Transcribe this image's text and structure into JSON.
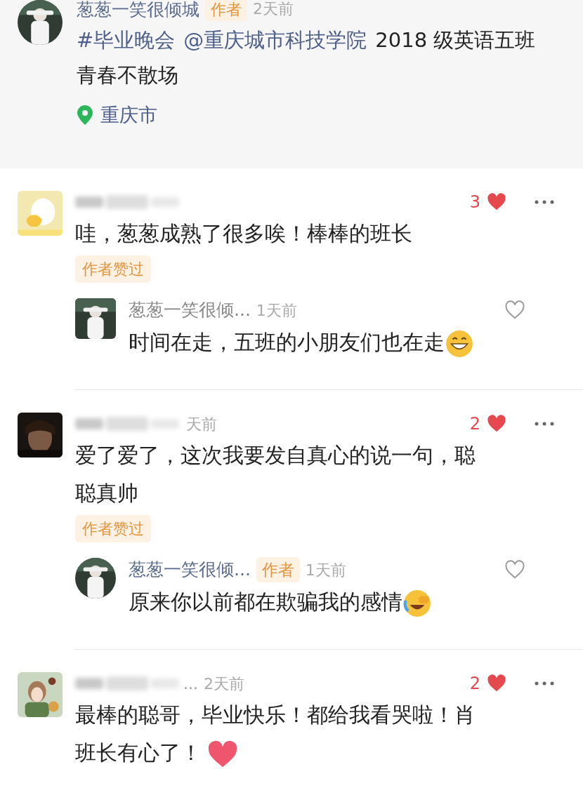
{
  "post": {
    "author": "葱葱一笑很倾城",
    "badge": "作者",
    "time": "2天前",
    "segments": [
      {
        "kind": "link",
        "text": "#毕业晚会"
      },
      {
        "kind": "link",
        "text": "@重庆城市科技学院"
      },
      {
        "kind": "plain",
        "text": "2018 级英语五班"
      },
      {
        "kind": "plain",
        "text": "青春不散场"
      }
    ],
    "location": "重庆市"
  },
  "comments": [
    {
      "text": "哇，葱葱成熟了很多唉！棒棒的班长",
      "likes": "3",
      "liked": true,
      "author_liked": "作者赞过",
      "replies": [
        {
          "name": "葱葱一笑很倾...",
          "time": "1天前",
          "text": "时间在走，五班的小朋友们也在走",
          "emoji": {
            "kind": "grin"
          },
          "liked": false
        }
      ]
    },
    {
      "time": "天前",
      "text": "爱了爱了，这次我要发自真心的说一句，聪聪真帅",
      "likes": "2",
      "liked": true,
      "author_liked": "作者赞过",
      "replies": [
        {
          "name": "葱葱一笑很倾...",
          "badge": "作者",
          "time": "1天前",
          "text": "原来你以前都在欺骗我的感情",
          "emoji": {
            "kind": "cry-laugh"
          },
          "liked": false
        }
      ]
    },
    {
      "name_tail": "...",
      "time": "2天前",
      "text": "最棒的聪哥，毕业快乐！都给我看哭啦！肖班长有心了！",
      "emoji": {
        "kind": "heart"
      },
      "likes": "2",
      "liked": true
    }
  ]
}
